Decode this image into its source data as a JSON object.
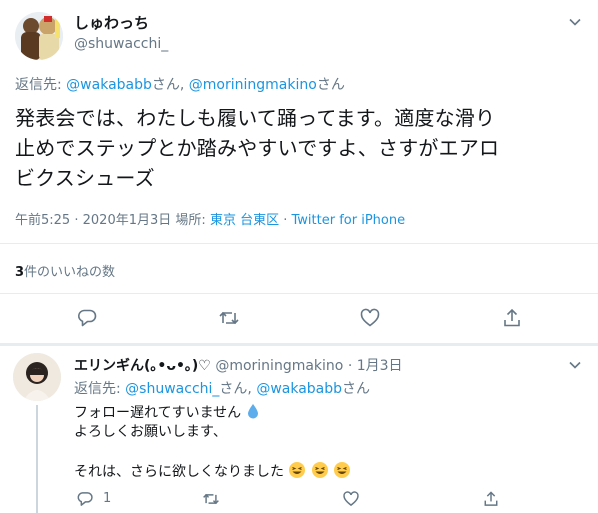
{
  "tweet": {
    "display_name": "しゅわっち",
    "handle": "@shuwacchi_",
    "reply_to_prefix": "返信先: ",
    "reply_to_user1": "@wakababb",
    "reply_to_sep1": "さん, ",
    "reply_to_user2": "@moriningmakino",
    "reply_to_sep2": "さん",
    "text_line1": "発表会では、わたしも履いて踊ってます。適度な滑り",
    "text_line2": "止めでステップとか踏みやすいですよ、さすがエアロ",
    "text_line3": "ビクスシューズ",
    "time": "午前5:25",
    "dot": "·",
    "date": "2020年1月3日",
    "place_label": "場所:",
    "place": "東京 台東区",
    "source": "Twitter for iPhone",
    "likes_count": "3",
    "likes_label": "件のいいねの数"
  },
  "reply": {
    "display_name": "エリンギん(｡•ᴗ•｡)♡",
    "handle": "@moriningmakino",
    "dot": "·",
    "date": "1月3日",
    "reply_to_prefix": "返信先: ",
    "reply_to_user1": "@shuwacchi_",
    "reply_to_sep1": "さん, ",
    "reply_to_user2": "@wakababb",
    "reply_to_sep2": "さん",
    "line1": "フォロー遅れてすいません",
    "line2": "よろしくお願いします、",
    "line3": "それは、さらに欲しくなりました",
    "reply_count": "1"
  },
  "colors": {
    "link": "#1b95e0",
    "muted": "#657786",
    "divider": "#e6ecf0",
    "icon": "#657786"
  },
  "icons": [
    "chevron-down-icon",
    "reply-icon",
    "retweet-icon",
    "like-icon",
    "share-icon",
    "droplet-emoji",
    "grinning-squinting-emoji"
  ]
}
